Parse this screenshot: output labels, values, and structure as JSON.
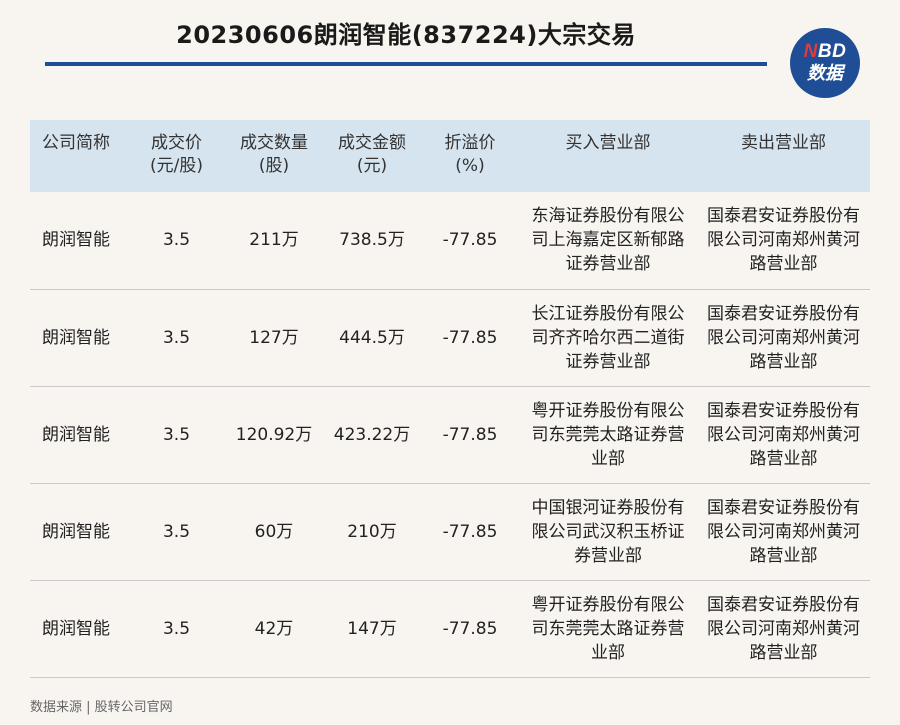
{
  "title": "20230606朗润智能(837224)大宗交易",
  "logo": {
    "line1_n": "N",
    "line1_rest": "BD",
    "line2": "数据"
  },
  "table": {
    "headers": [
      [
        "公司简称"
      ],
      [
        "成交价",
        "(元/股)"
      ],
      [
        "成交数量",
        "(股)"
      ],
      [
        "成交金额",
        "(元)"
      ],
      [
        "折溢价",
        "(%)"
      ],
      [
        "买入营业部"
      ],
      [
        "卖出营业部"
      ]
    ],
    "rows": [
      [
        "朗润智能",
        "3.5",
        "211万",
        "738.5万",
        "-77.85",
        "东海证券股份有限公司上海嘉定区新郁路证券营业部",
        "国泰君安证券股份有限公司河南郑州黄河路营业部"
      ],
      [
        "朗润智能",
        "3.5",
        "127万",
        "444.5万",
        "-77.85",
        "长江证券股份有限公司齐齐哈尔西二道街证券营业部",
        "国泰君安证券股份有限公司河南郑州黄河路营业部"
      ],
      [
        "朗润智能",
        "3.5",
        "120.92万",
        "423.22万",
        "-77.85",
        "粤开证券股份有限公司东莞莞太路证券营业部",
        "国泰君安证券股份有限公司河南郑州黄河路营业部"
      ],
      [
        "朗润智能",
        "3.5",
        "60万",
        "210万",
        "-77.85",
        "中国银河证券股份有限公司武汉积玉桥证券营业部",
        "国泰君安证券股份有限公司河南郑州黄河路营业部"
      ],
      [
        "朗润智能",
        "3.5",
        "42万",
        "147万",
        "-77.85",
        "粤开证券股份有限公司东莞莞太路证券营业部",
        "国泰君安证券股份有限公司河南郑州黄河路营业部"
      ]
    ]
  },
  "source": "数据来源 | 股转公司官网"
}
